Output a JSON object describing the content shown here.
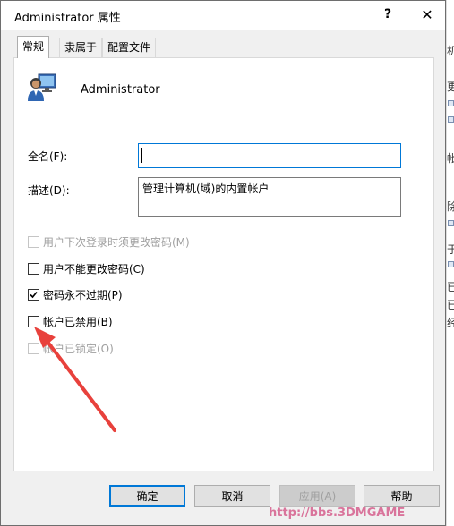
{
  "window": {
    "title": "Administrator 属性",
    "help_label": "?",
    "close_label": "✕"
  },
  "tabs": [
    {
      "label": "常规",
      "active": true
    },
    {
      "label": "隶属于",
      "active": false
    },
    {
      "label": "配置文件",
      "active": false
    }
  ],
  "general": {
    "username": "Administrator",
    "fullname_label": "全名(F):",
    "fullname_value": "",
    "description_label": "描述(D):",
    "description_value": "管理计算机(域)的内置帐户"
  },
  "checkboxes": [
    {
      "label": "用户下次登录时须更改密码(M)",
      "checked": false,
      "disabled": true
    },
    {
      "label": "用户不能更改密码(C)",
      "checked": false,
      "disabled": false
    },
    {
      "label": "密码永不过期(P)",
      "checked": true,
      "disabled": false
    },
    {
      "label": "帐户已禁用(B)",
      "checked": false,
      "disabled": false
    },
    {
      "label": "帐户已锁定(O)",
      "checked": false,
      "disabled": true
    }
  ],
  "buttons": {
    "ok": "确定",
    "cancel": "取消",
    "apply": "应用(A)",
    "help": "帮助"
  },
  "background_window": {
    "fragments": [
      "机",
      "更",
      "帐",
      "除",
      "于",
      "已",
      "已",
      "经"
    ]
  },
  "watermark": {
    "text": "http://bbs.3DMGAME"
  },
  "colors": {
    "accent": "#0078d7",
    "annotation_arrow": "#e8413c"
  }
}
